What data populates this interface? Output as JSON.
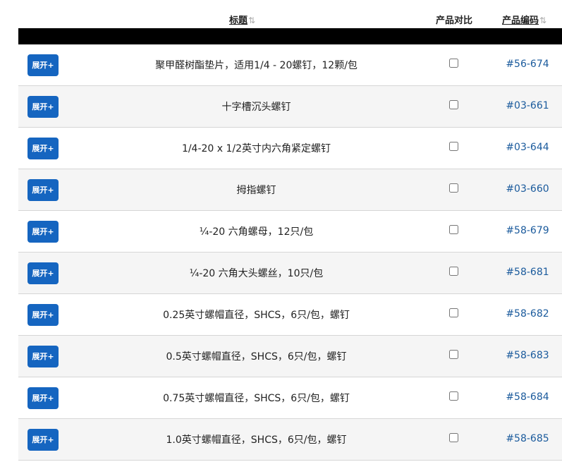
{
  "header": {
    "title_label": "标题",
    "compare_label": "产品对比",
    "code_label": "产品编码",
    "sort_icon": "sort-icon"
  },
  "colors": {
    "button_bg": "#1565c0",
    "link": "#1a5a9c",
    "bar": "#000000",
    "alt_row": "#f5f5f5"
  },
  "rows": [
    {
      "expand_label": "展开+",
      "title": "聚甲醛树酯垫片，适用1/4 - 20螺钉，12颗/包",
      "code": "#56-674"
    },
    {
      "expand_label": "展开+",
      "title": "十字槽沉头螺钉",
      "code": "#03-661"
    },
    {
      "expand_label": "展开+",
      "title": "1/4-20 x 1/2英寸内六角紧定螺钉",
      "code": "#03-644"
    },
    {
      "expand_label": "展开+",
      "title": "拇指螺钉",
      "code": "#03-660"
    },
    {
      "expand_label": "展开+",
      "title": "¼-20 六角螺母，12只/包",
      "code": "#58-679"
    },
    {
      "expand_label": "展开+",
      "title": "¼-20 六角大头螺丝，10只/包",
      "code": "#58-681"
    },
    {
      "expand_label": "展开+",
      "title": "0.25英寸螺帽直径，SHCS，6只/包，螺钉",
      "code": "#58-682"
    },
    {
      "expand_label": "展开+",
      "title": "0.5英寸螺帽直径，SHCS，6只/包，螺钉",
      "code": "#58-683"
    },
    {
      "expand_label": "展开+",
      "title": "0.75英寸螺帽直径，SHCS，6只/包，螺钉",
      "code": "#58-684"
    },
    {
      "expand_label": "展开+",
      "title": "1.0英寸螺帽直径，SHCS，6只/包，螺钉",
      "code": "#58-685"
    }
  ]
}
